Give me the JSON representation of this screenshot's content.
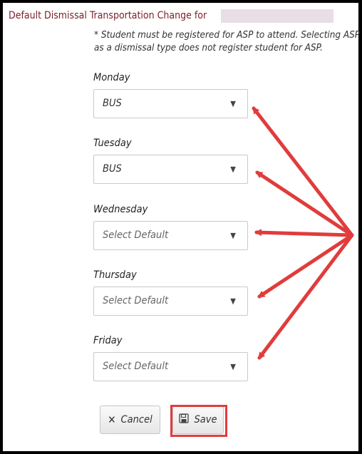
{
  "header": {
    "title": "Default Dismissal Transportation Change for"
  },
  "note": "* Student must be registered for ASP to attend. Selecting ASP as a dismissal type does not register student for ASP.",
  "days": [
    {
      "label": "Monday",
      "value": "BUS"
    },
    {
      "label": "Tuesday",
      "value": "BUS"
    },
    {
      "label": "Wednesday",
      "value": "Select Default"
    },
    {
      "label": "Thursday",
      "value": "Select Default"
    },
    {
      "label": "Friday",
      "value": "Select Default"
    }
  ],
  "buttons": {
    "cancel_label": "Cancel",
    "save_label": "Save"
  },
  "colors": {
    "title": "#7a1f2b",
    "annotation_arrow": "#e03c3c"
  },
  "icons": {
    "cancel": "close-icon",
    "save": "floppy-disk-icon",
    "dropdown": "chevron-down-icon"
  }
}
